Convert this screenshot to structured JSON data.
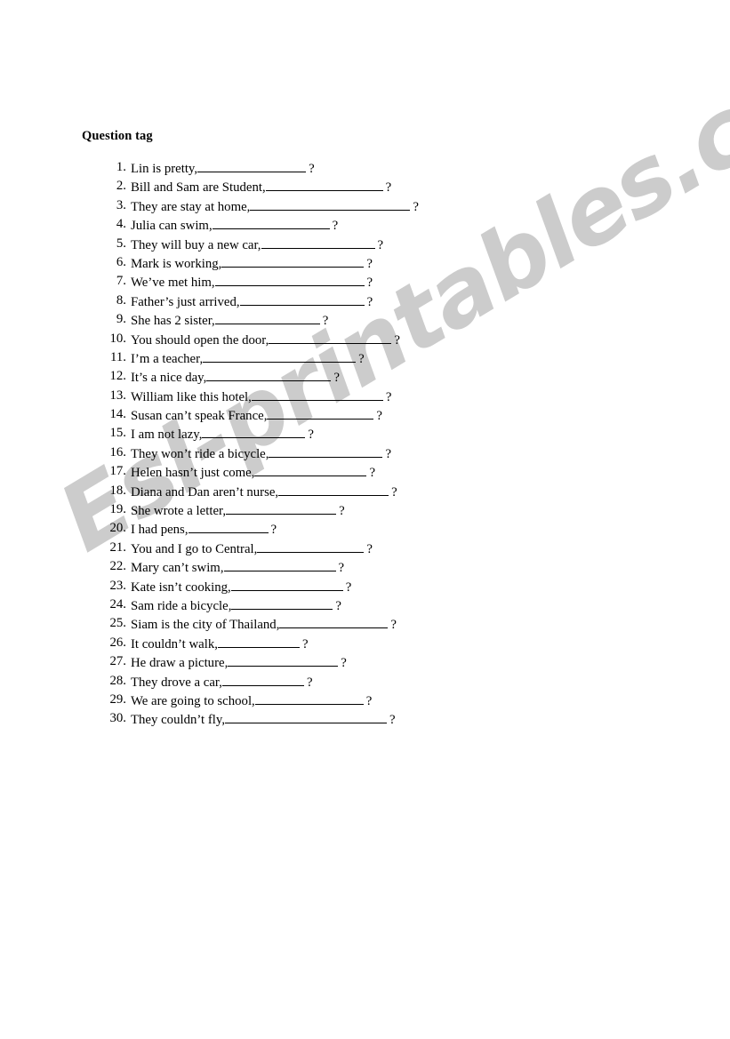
{
  "document": {
    "title": "Question tag",
    "watermark": "Esl-printables.com",
    "watermark_color": "#cccccc",
    "text_color": "#000000",
    "background_color": "#ffffff"
  },
  "worksheet": {
    "items": [
      {
        "number": "1.",
        "text": "Lin is pretty,",
        "blank_width": 122,
        "question_mark": "?"
      },
      {
        "number": "2.",
        "text": "Bill and Sam are Student,",
        "blank_width": 132,
        "question_mark": "?"
      },
      {
        "number": "3.",
        "text": "They are stay at home,",
        "blank_width": 180,
        "question_mark": "?"
      },
      {
        "number": "4.",
        "text": "Julia can swim,",
        "blank_width": 132,
        "question_mark": "?"
      },
      {
        "number": "5.",
        "text": "They will buy a new car,",
        "blank_width": 128,
        "question_mark": "?"
      },
      {
        "number": "6.",
        "text": "Mark is working,",
        "blank_width": 160,
        "question_mark": "?"
      },
      {
        "number": "7.",
        "text": "We’ve met him,",
        "blank_width": 168,
        "question_mark": "?"
      },
      {
        "number": "8.",
        "text": "Father’s just arrived,",
        "blank_width": 140,
        "question_mark": "?"
      },
      {
        "number": "9.",
        "text": "She has 2 sister,",
        "blank_width": 118,
        "question_mark": "?"
      },
      {
        "number": "10.",
        "text": "You should open the door,",
        "blank_width": 138,
        "question_mark": "?"
      },
      {
        "number": "11.",
        "text": "I’m a teacher,",
        "blank_width": 172,
        "question_mark": "?"
      },
      {
        "number": "12.",
        "text": "It’s a nice day,",
        "blank_width": 140,
        "question_mark": "?"
      },
      {
        "number": "13.",
        "text": "William like this hotel,",
        "blank_width": 148,
        "question_mark": "?"
      },
      {
        "number": "14.",
        "text": "Susan can’t speak France,",
        "blank_width": 120,
        "question_mark": "?"
      },
      {
        "number": "15.",
        "text": "I am not lazy,",
        "blank_width": 116,
        "question_mark": "?"
      },
      {
        "number": "16.",
        "text": "They won’t ride a bicycle,",
        "blank_width": 128,
        "question_mark": "?"
      },
      {
        "number": "17.",
        "text": "Helen hasn’t just come,",
        "blank_width": 126,
        "question_mark": "?"
      },
      {
        "number": "18.",
        "text": "Diana and Dan aren’t nurse,",
        "blank_width": 124,
        "question_mark": "?"
      },
      {
        "number": "19.",
        "text": "She wrote a letter,",
        "blank_width": 124,
        "question_mark": "?"
      },
      {
        "number": "20.",
        "text": "I had pens,",
        "blank_width": 90,
        "question_mark": "?"
      },
      {
        "number": "21.",
        "text": "You and I go to Central,",
        "blank_width": 120,
        "question_mark": "?"
      },
      {
        "number": "22.",
        "text": "Mary can’t swim,",
        "blank_width": 126,
        "question_mark": "?"
      },
      {
        "number": "23.",
        "text": "Kate isn’t cooking,",
        "blank_width": 126,
        "question_mark": "?"
      },
      {
        "number": "24.",
        "text": "Sam ride a bicycle,",
        "blank_width": 114,
        "question_mark": "?"
      },
      {
        "number": "25.",
        "text": "Siam is the city of Thailand,",
        "blank_width": 122,
        "question_mark": "?"
      },
      {
        "number": "26.",
        "text": "It couldn’t walk,",
        "blank_width": 92,
        "question_mark": "?"
      },
      {
        "number": "27.",
        "text": "He draw a picture,",
        "blank_width": 124,
        "question_mark": "?"
      },
      {
        "number": "28.",
        "text": "They drove a car,",
        "blank_width": 92,
        "question_mark": "?"
      },
      {
        "number": "29.",
        "text": "We are going to school,",
        "blank_width": 122,
        "question_mark": "?"
      },
      {
        "number": "30.",
        "text": "They couldn’t fly,",
        "blank_width": 182,
        "question_mark": "?"
      }
    ]
  }
}
